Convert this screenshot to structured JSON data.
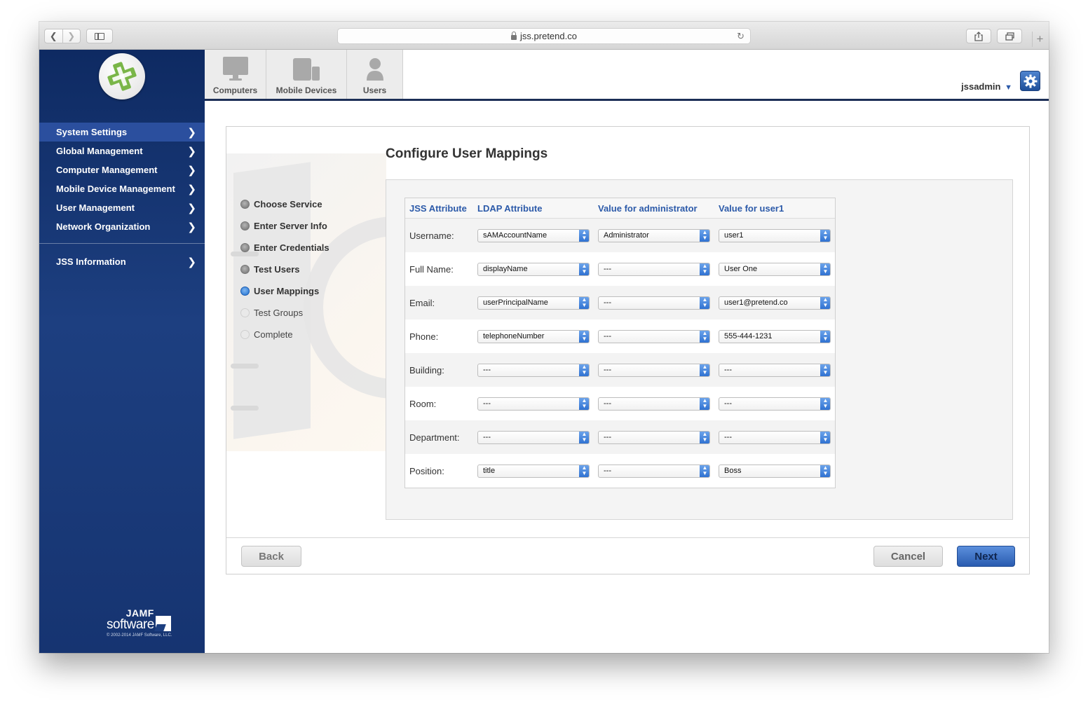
{
  "browser": {
    "url": "jss.pretend.co"
  },
  "sidebar": {
    "items": [
      {
        "label": "System Settings"
      },
      {
        "label": "Global Management"
      },
      {
        "label": "Computer Management"
      },
      {
        "label": "Mobile Device Management"
      },
      {
        "label": "User Management"
      },
      {
        "label": "Network Organization"
      }
    ],
    "info_item": {
      "label": "JSS Information"
    },
    "brand": {
      "line1": "JAMF",
      "line2": "software",
      "copyright": "© 2002-2014 JAMF Software, LLC."
    }
  },
  "topnav": {
    "computers": "Computers",
    "mobile": "Mobile Devices",
    "users": "Users",
    "username": "jssadmin"
  },
  "page": {
    "title": "Configure User Mappings",
    "steps": [
      {
        "label": "Choose Service"
      },
      {
        "label": "Enter Server Info"
      },
      {
        "label": "Enter Credentials"
      },
      {
        "label": "Test Users"
      },
      {
        "label": "User Mappings"
      },
      {
        "label": "Test Groups"
      },
      {
        "label": "Complete"
      }
    ]
  },
  "table": {
    "headers": [
      "JSS Attribute",
      "LDAP Attribute",
      "Value for administrator",
      "Value for user1"
    ],
    "rows": [
      {
        "label": "Username:",
        "ldap": "sAMAccountName",
        "admin": "Administrator",
        "user1": "user1"
      },
      {
        "label": "Full Name:",
        "ldap": "displayName",
        "admin": "---",
        "user1": "User One"
      },
      {
        "label": "Email:",
        "ldap": "userPrincipalName",
        "admin": "---",
        "user1": "user1@pretend.co"
      },
      {
        "label": "Phone:",
        "ldap": "telephoneNumber",
        "admin": "---",
        "user1": "555-444-1231"
      },
      {
        "label": "Building:",
        "ldap": "---",
        "admin": "---",
        "user1": "---"
      },
      {
        "label": "Room:",
        "ldap": "---",
        "admin": "---",
        "user1": "---"
      },
      {
        "label": "Department:",
        "ldap": "---",
        "admin": "---",
        "user1": "---"
      },
      {
        "label": "Position:",
        "ldap": "title",
        "admin": "---",
        "user1": "Boss"
      }
    ]
  },
  "buttons": {
    "back": "Back",
    "cancel": "Cancel",
    "next": "Next"
  },
  "colors": {
    "sidebar": "#1d3f80",
    "accent": "#2c5aa9",
    "logo_green": "#7ab648"
  }
}
